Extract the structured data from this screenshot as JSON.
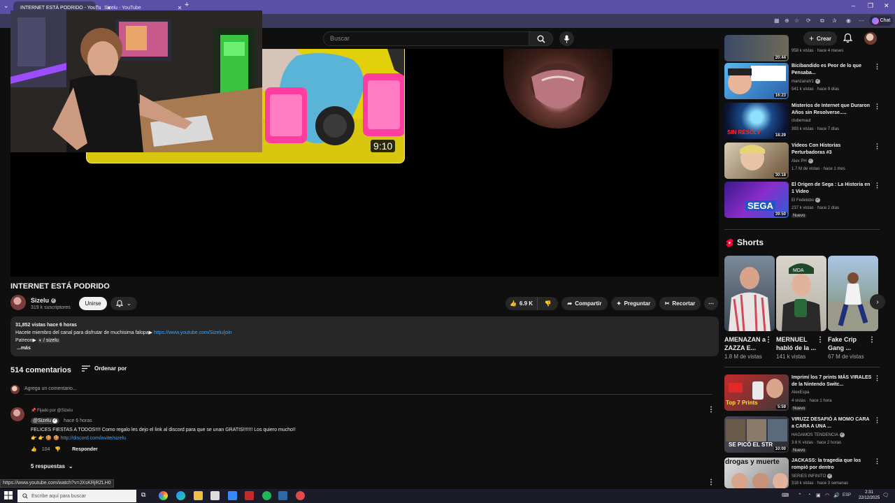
{
  "browser": {
    "tabs": [
      {
        "title": "INTERNET ESTÁ PODRIDO - YouTu",
        "active": true
      },
      {
        "title": "Sizelu - YouTube",
        "active": false
      }
    ],
    "new_tab": "+",
    "chat_label": "Chat"
  },
  "header": {
    "search_placeholder": "Buscar",
    "create_label": "Crear"
  },
  "player": {
    "thumb_duration": "9:10"
  },
  "video": {
    "title": "INTERNET ESTÁ PODRIDO",
    "channel": "Sizelu",
    "subscribers": "319 k suscriptores",
    "join_label": "Unirse",
    "likes": "6.9 K",
    "share_label": "Compartir",
    "ask_label": "Preguntar",
    "clip_label": "Recortar"
  },
  "description": {
    "stats": "31,852 vistas  hace 6 horas",
    "line1_text": "Hacete miembro del canal para disfrutar de muchisima falopa▶ ",
    "line1_link": "https://www.youtube.com/Sizelu/join",
    "line2_prefix": "Patreon▶ ",
    "line2_link": " / sizelu",
    "more": "...más"
  },
  "comments": {
    "count": "514 comentarios",
    "sort_label": "Ordenar por",
    "add_placeholder": "Agrega un comentario...",
    "pinned_label": "Fijado por @Sizelu",
    "author": "@Sizelu",
    "time": "hace 6 horas",
    "text": "FELICES FIESTAS A TODOS!!!! Como regalo les dejo el link al discord para que se unan GRATIS!!!!!!! Los quiero mucho!!",
    "link_prefix": "👉 👉 🍪 🍪",
    "link": "http://discord.com/invite/sizelu",
    "likes": "104",
    "reply_label": "Responder",
    "replies": "5 respuestas"
  },
  "status_url": "https://www.youtube.com/watch?v=JXsKRjRZLH0",
  "sidebar": {
    "top_meta": "958 k vistas · hace 4 meses",
    "top_duration": "20:44",
    "recs": [
      {
        "title": "Bicibandido es Peor de lo que Pensaba...",
        "channel": "manzanaV1",
        "verified": true,
        "meta": "541 k vistas · hace 9 días",
        "duration": "16:23",
        "new": ""
      },
      {
        "title": "Misterios de Internet que Duraron Años sin Resolverse.....",
        "channel": "clubemaut",
        "verified": false,
        "meta": "393 k vistas · hace 7 días",
        "duration": "18:29",
        "new": ""
      },
      {
        "title": "Videos Con Historias Perturbadoras #3",
        "channel": "Alex PH",
        "verified": true,
        "meta": "1.7 M de vistas · hace 1 mes",
        "duration": "30:18",
        "new": ""
      },
      {
        "title": "El Origen de Sega : La Historia en 1 Video",
        "channel": "El Fedelobo",
        "verified": true,
        "meta": "237 k vistas · hace 2 días",
        "duration": "39:50",
        "new": "Nuevo"
      }
    ],
    "shorts_label": "Shorts",
    "shorts": [
      {
        "title": "AMENAZAN a ZAZZA E...",
        "views": "1.8 M de vistas"
      },
      {
        "title": "MERNUEL habló de la ...",
        "views": "141 k vistas"
      },
      {
        "title": "Fake Crip Gang ...",
        "views": "67 M de vistas"
      }
    ],
    "recs2": [
      {
        "title": "Imprimí los 7 prints MÁS VIRALES de la Nintendo Switc...",
        "channel": "AlexEspa",
        "verified": false,
        "meta": "4 vistas · hace 1 hora",
        "duration": "5:59",
        "new": "Nuevo"
      },
      {
        "title": "VIRUZZ DESAFIÓ A MOMO CARA a CARA A UNA ...",
        "channel": "HAGAMOS TENDENCIA",
        "verified": true,
        "meta": "3.6 K vistas · hace 2 horas",
        "duration": "10:00",
        "new": "Nuevo"
      },
      {
        "title": "JACKASS: la tragedia que los rompió por dentro",
        "channel": "SERIES INFINITO",
        "verified": true,
        "meta": "318 k vistas · hace 3 semanas",
        "duration": "",
        "new": ""
      }
    ]
  },
  "thumb_texts": {
    "sin_resolver": "SIN RESOLV",
    "sega": "SEGA",
    "top7": "Top 7 Prints",
    "se_pico": "SE PICÓ EL STR",
    "drogas": "drogas y muerte",
    "mda": "MDA"
  },
  "taskbar": {
    "search_placeholder": "Escribe aquí para buscar",
    "lang": "ESP",
    "time": "2:31",
    "date": "22/12/2025"
  }
}
